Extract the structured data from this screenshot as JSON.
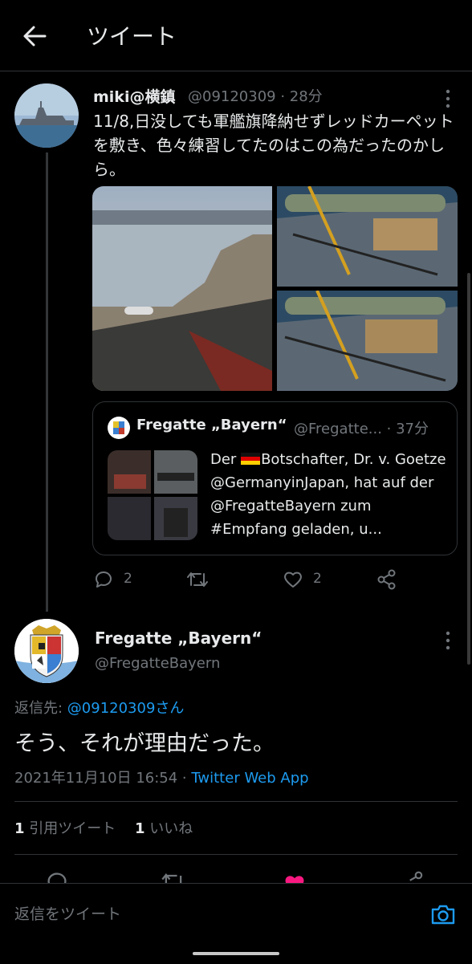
{
  "header": {
    "title": "ツイート"
  },
  "tweet": {
    "name": "miki@横鎮",
    "handle_time": "@09120309 · 28分",
    "text": "11/8,日没しても軍艦旗降納せずレッドカーペットを敷き、色々練習してたのはこの為だったのかしら。",
    "quote": {
      "name": "Fregatte „Bayern“",
      "handle_time": "@Fregatte... · 37分",
      "text_before_flag": "Der ",
      "text_after_flag": "Botschafter, Dr. v. Goetze @GermanyinJapan, hat auf der @FregatteBayern zum #Empfang geladen, u..."
    },
    "actions": {
      "replies": "2",
      "likes": "2"
    }
  },
  "reply": {
    "name": "Fregatte „Bayern“",
    "handle": "@FregatteBayern",
    "reply_to_label": "返信先: ",
    "reply_to_user": "@09120309さん",
    "text": "そう、それが理由だった。",
    "datetime": "2021年11月10日 16:54 · ",
    "client": "Twitter Web App",
    "quote_count": "1",
    "quote_label": " 引用ツイート",
    "like_count": "1",
    "like_label": " いいね"
  },
  "compose": {
    "placeholder": "返信をツイート"
  },
  "colors": {
    "accent": "#1d9bf0",
    "like": "#f91880",
    "background": "#000000"
  }
}
